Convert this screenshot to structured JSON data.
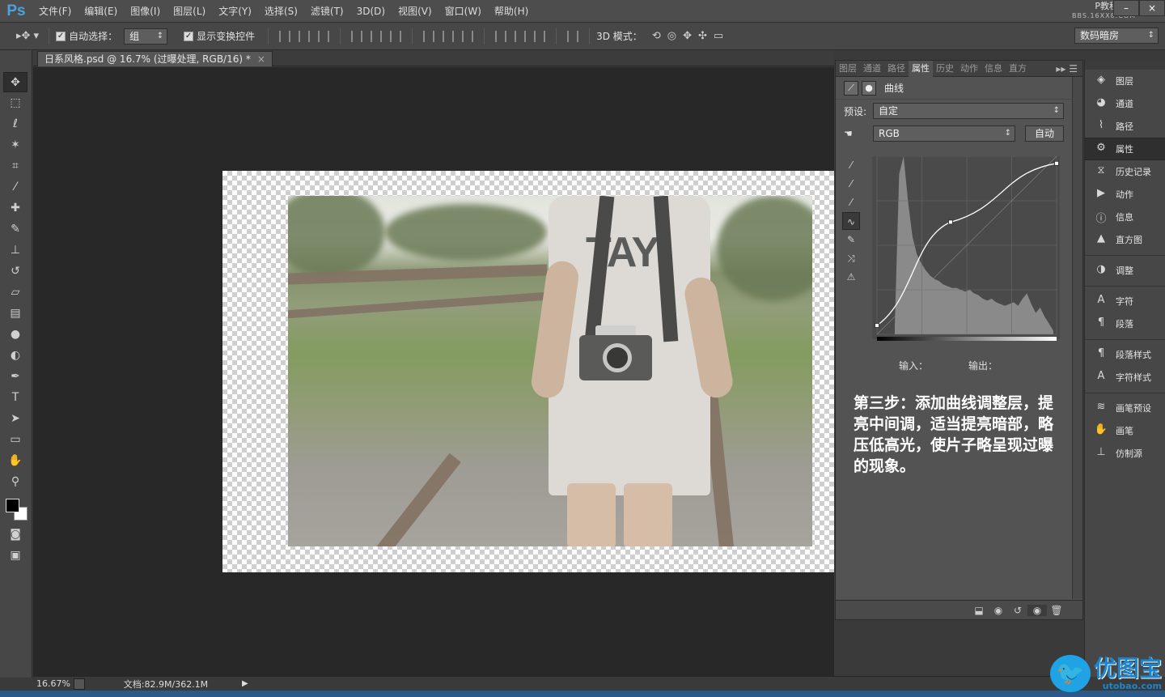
{
  "app": {
    "logo": "Ps"
  },
  "menu": [
    "文件(F)",
    "编辑(E)",
    "图像(I)",
    "图层(L)",
    "文字(Y)",
    "选择(S)",
    "滤镜(T)",
    "3D(D)",
    "视图(V)",
    "窗口(W)",
    "帮助(H)"
  ],
  "window_controls": [
    "–",
    "×"
  ],
  "site_mark": {
    "title": "P教程论坛",
    "url": "BBS.16XX8.COM"
  },
  "options": {
    "auto_select_label": "自动选择：",
    "auto_select_value": "组",
    "show_transform_label": "显示变换控件",
    "mode_3d_label": "3D 模式：",
    "workspace": "数码暗房"
  },
  "document_tab": {
    "title": "日系风格.psd @ 16.7% (过曝处理, RGB/16) *",
    "close": "×"
  },
  "panel": {
    "tabs": [
      "图层",
      "通道",
      "路径",
      "属性",
      "历史",
      "动作",
      "信息",
      "直方"
    ],
    "active_tab": "属性",
    "curves_title": "曲线",
    "preset_label": "预设:",
    "preset_value": "自定",
    "channel_value": "RGB",
    "auto_button": "自动",
    "input_label": "输入：",
    "output_label": "输出："
  },
  "curve": {
    "points": [
      [
        0,
        0.05
      ],
      [
        0.41,
        0.63
      ],
      [
        1,
        0.96
      ]
    ]
  },
  "step_note": "第三步：添加曲线调整层，提亮中间调，适当提亮暗部，略压低高光，使片子略呈现过曝的现象。",
  "strip": [
    {
      "icon": "layers-icon",
      "label": "图层"
    },
    {
      "icon": "channels-icon",
      "label": "通道"
    },
    {
      "icon": "paths-icon",
      "label": "路径"
    },
    {
      "icon": "properties-icon",
      "label": "属性"
    },
    {
      "icon": "history-icon",
      "label": "历史记录"
    },
    {
      "icon": "actions-icon",
      "label": "动作"
    },
    {
      "icon": "info-icon",
      "label": "信息"
    },
    {
      "icon": "histogram-icon",
      "label": "直方图"
    },
    {
      "icon": "adjustments-icon",
      "label": "调整"
    },
    {
      "icon": "character-icon",
      "label": "字符"
    },
    {
      "icon": "paragraph-icon",
      "label": "段落"
    },
    {
      "icon": "paragraph-styles-icon",
      "label": "段落样式"
    },
    {
      "icon": "character-styles-icon",
      "label": "字符样式"
    },
    {
      "icon": "brush-presets-icon",
      "label": "画笔预设"
    },
    {
      "icon": "brush-icon",
      "label": "画笔"
    },
    {
      "icon": "clone-source-icon",
      "label": "仿制源"
    }
  ],
  "status": {
    "zoom": "16.67%",
    "doc_size": "文档:82.9M/362.1M"
  },
  "photo_text": "TAY",
  "watermark": {
    "title": "优图宝",
    "domain": "utobao.com"
  }
}
